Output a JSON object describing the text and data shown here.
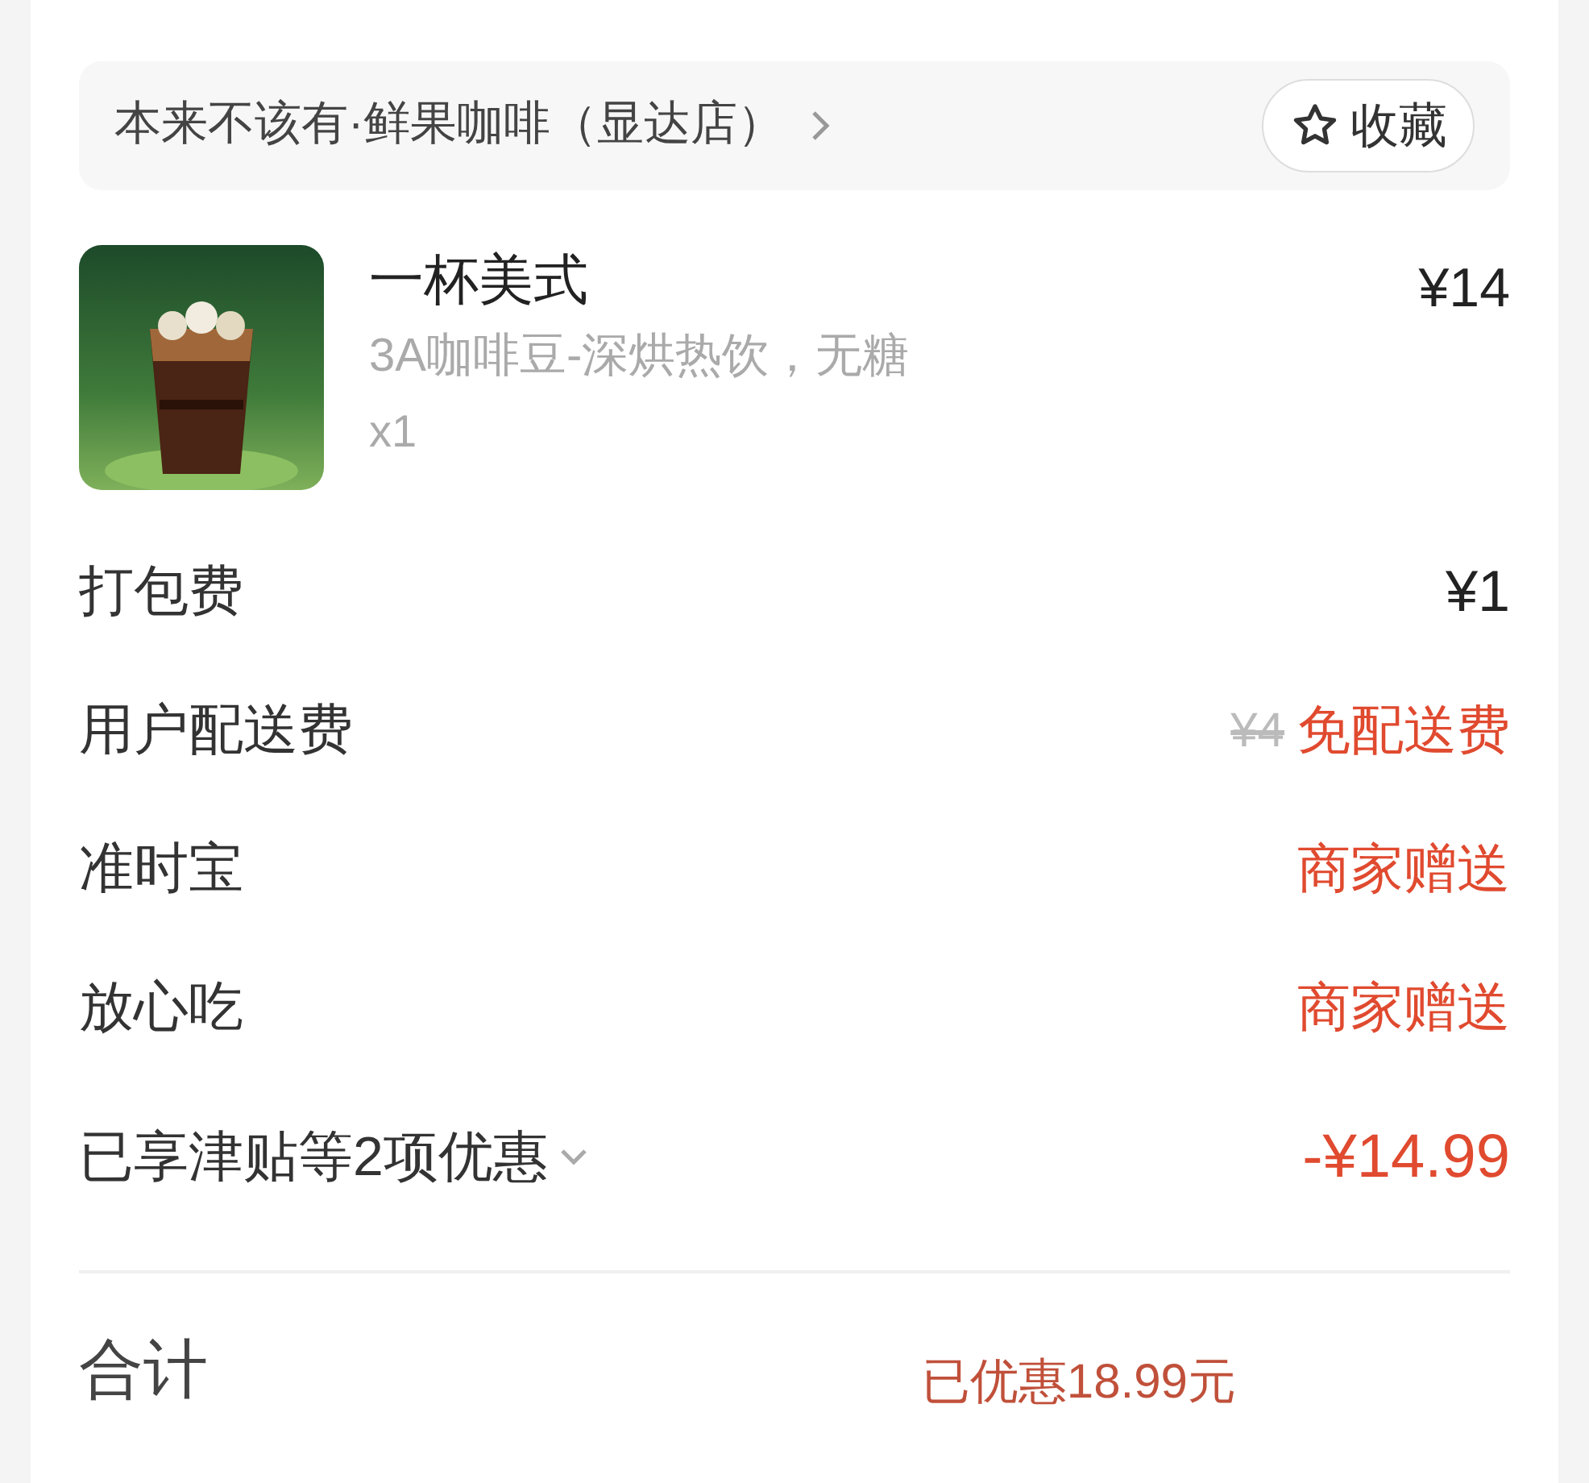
{
  "shop": {
    "name": "本来不该有·鲜果咖啡（显达店）",
    "favorite_label": "收藏"
  },
  "item": {
    "name": "一杯美式",
    "spec": "3A咖啡豆-深烘热饮，无糖",
    "quantity": "x1",
    "price": "¥14"
  },
  "fees": [
    {
      "label": "打包费",
      "value": "¥1",
      "kind": "price"
    },
    {
      "label": "用户配送费",
      "original": "¥4",
      "value": "免配送费",
      "kind": "promo"
    },
    {
      "label": "准时宝",
      "value": "商家赠送",
      "kind": "promo"
    },
    {
      "label": "放心吃",
      "value": "商家赠送",
      "kind": "promo"
    }
  ],
  "discount": {
    "label": "已享津贴等2项优惠",
    "amount": "-¥14.99"
  },
  "total": {
    "label": "合计",
    "saved": "已优惠18.99元"
  }
}
